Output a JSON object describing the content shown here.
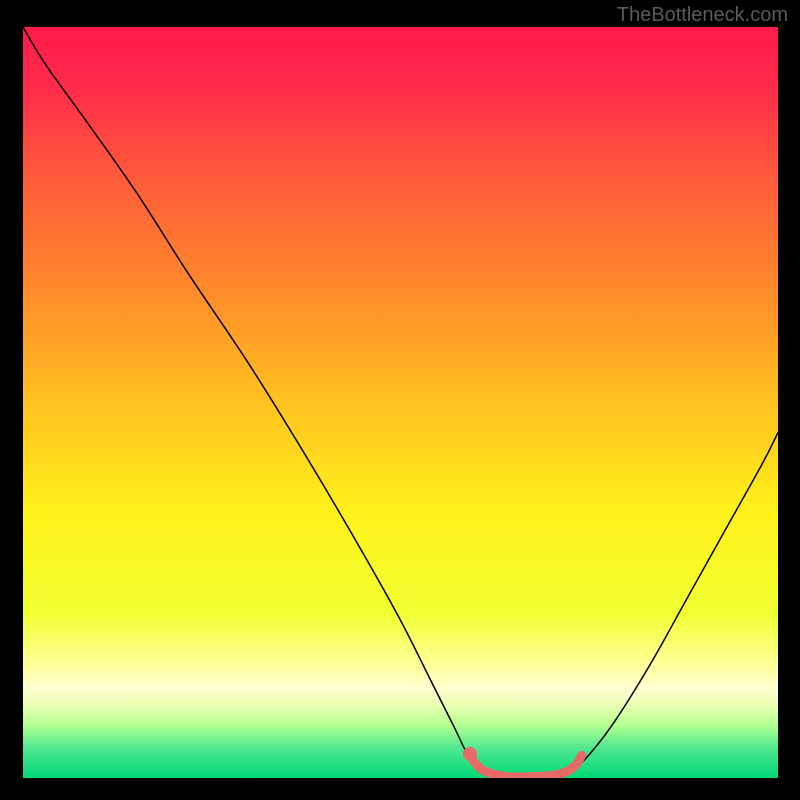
{
  "watermark": "TheBottleneck.com",
  "chart_data": {
    "type": "line",
    "title": "",
    "xlabel": "",
    "ylabel": "",
    "xlim": [
      0,
      100
    ],
    "ylim": [
      0,
      100
    ],
    "background_gradient": {
      "stops": [
        {
          "offset": 0.0,
          "color": "#ff1a4a"
        },
        {
          "offset": 0.08,
          "color": "#ff2b4a"
        },
        {
          "offset": 0.2,
          "color": "#ff5a3a"
        },
        {
          "offset": 0.35,
          "color": "#ff8a2a"
        },
        {
          "offset": 0.5,
          "color": "#ffc21f"
        },
        {
          "offset": 0.65,
          "color": "#fff21a"
        },
        {
          "offset": 0.78,
          "color": "#f0ff30"
        },
        {
          "offset": 0.85,
          "color": "#ffff9a"
        },
        {
          "offset": 0.88,
          "color": "#ffffd0"
        },
        {
          "offset": 0.905,
          "color": "#e8ffb0"
        },
        {
          "offset": 0.93,
          "color": "#b0ff90"
        },
        {
          "offset": 0.96,
          "color": "#50e890"
        },
        {
          "offset": 1.0,
          "color": "#00d877"
        }
      ]
    },
    "series": [
      {
        "name": "bottleneck-curve",
        "color": "#000000",
        "width": 1.5,
        "points": [
          {
            "x": 0.0,
            "y": 100.0
          },
          {
            "x": 3.0,
            "y": 95.0
          },
          {
            "x": 8.0,
            "y": 88.0
          },
          {
            "x": 15.0,
            "y": 78.0
          },
          {
            "x": 22.0,
            "y": 67.0
          },
          {
            "x": 30.0,
            "y": 55.0
          },
          {
            "x": 38.0,
            "y": 42.0
          },
          {
            "x": 45.0,
            "y": 30.0
          },
          {
            "x": 50.0,
            "y": 21.0
          },
          {
            "x": 54.0,
            "y": 13.0
          },
          {
            "x": 57.0,
            "y": 7.0
          },
          {
            "x": 59.0,
            "y": 3.0
          },
          {
            "x": 61.0,
            "y": 1.0
          },
          {
            "x": 64.0,
            "y": 0.0
          },
          {
            "x": 68.0,
            "y": 0.0
          },
          {
            "x": 72.0,
            "y": 0.5
          },
          {
            "x": 74.0,
            "y": 2.0
          },
          {
            "x": 78.0,
            "y": 7.0
          },
          {
            "x": 83.0,
            "y": 15.0
          },
          {
            "x": 88.0,
            "y": 24.0
          },
          {
            "x": 93.0,
            "y": 33.0
          },
          {
            "x": 98.0,
            "y": 42.0
          },
          {
            "x": 100.0,
            "y": 46.0
          }
        ]
      },
      {
        "name": "optimal-range-highlight",
        "color": "#e76a66",
        "width": 9,
        "linecap": "round",
        "points": [
          {
            "x": 59.5,
            "y": 2.5
          },
          {
            "x": 61.0,
            "y": 1.0
          },
          {
            "x": 64.0,
            "y": 0.2
          },
          {
            "x": 68.0,
            "y": 0.2
          },
          {
            "x": 71.0,
            "y": 0.5
          },
          {
            "x": 73.0,
            "y": 1.5
          },
          {
            "x": 74.0,
            "y": 3.0
          }
        ]
      },
      {
        "name": "highlight-dot-left",
        "type": "point",
        "color": "#e76a66",
        "radius": 7,
        "x": 59.2,
        "y": 3.2
      }
    ]
  }
}
